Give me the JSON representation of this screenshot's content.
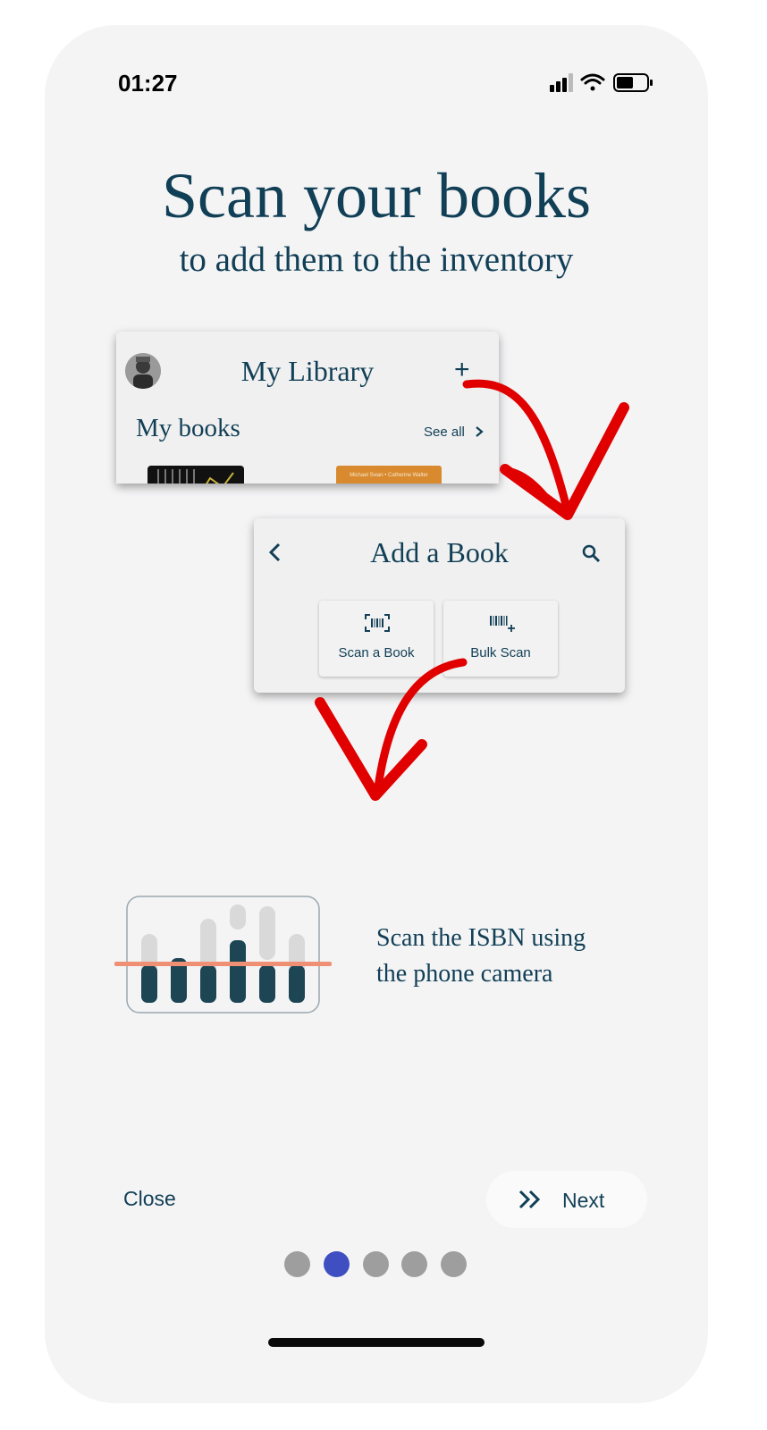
{
  "status_bar": {
    "time": "01:27"
  },
  "header": {
    "title": "Scan your books",
    "subtitle": "to add them to the inventory"
  },
  "library_card": {
    "title": "My Library",
    "add_symbol": "+",
    "section_label": "My books",
    "see_all": "See all",
    "book_cover_text": "Michael Swan • Catherine Walter"
  },
  "add_book_card": {
    "title": "Add a Book",
    "options": [
      {
        "label": "Scan a Book",
        "icon": "barcode-scan-icon"
      },
      {
        "label": "Bulk Scan",
        "icon": "barcode-plus-icon"
      }
    ]
  },
  "instruction": {
    "line1": "Scan the ISBN using",
    "line2": "the phone camera"
  },
  "footer": {
    "close_label": "Close",
    "next_label": "Next"
  },
  "pagination": {
    "count": 5,
    "active_index": 1
  },
  "colors": {
    "accent": "#113f56",
    "arrow": "#e00000",
    "active_dot": "#3f4fc1",
    "inactive_dot": "#9e9e9e",
    "scan_line": "#ef8f73"
  }
}
